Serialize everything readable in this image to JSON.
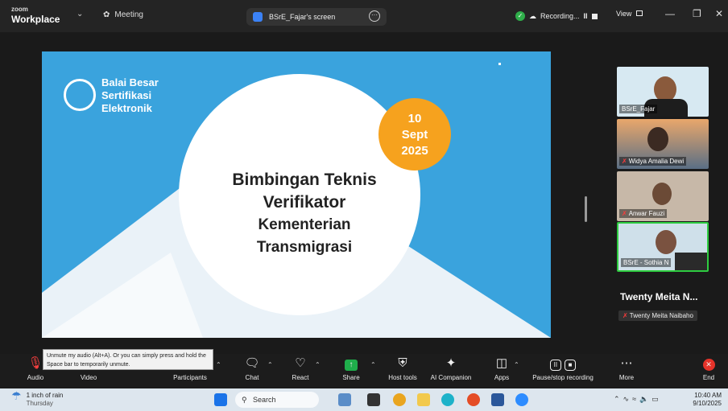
{
  "titlebar": {
    "brand_line1": "zoom",
    "brand_line2": "Workplace",
    "meeting_tab": "Meeting",
    "share_tab": "BSrE_Fajar's screen",
    "recording_label": "Recording...",
    "view_label": "View"
  },
  "slide": {
    "logo_lines": [
      "Balai Besar",
      "Sertifikasi",
      "Elektronik"
    ],
    "date_lines": [
      "10",
      "Sept",
      "2025"
    ],
    "title_lines": [
      "Bimbingan Teknis",
      "Verifikator",
      "Kementerian",
      "Transmigrasi"
    ],
    "colors": {
      "background": "#3aa3dd",
      "accent": "#f6a21e"
    }
  },
  "participants": [
    {
      "name": "BSrE_Fajar",
      "muted": false
    },
    {
      "name": "Widya Amalia Dewi",
      "muted": true
    },
    {
      "name": "Anwar Fauzi",
      "muted": true
    },
    {
      "name": "BSrE - Sothia N",
      "muted": false
    }
  ],
  "speaker": {
    "name": "Twenty Meita N...",
    "sub_label": "Twenty Meita Naibaho"
  },
  "tooltip": {
    "text": "Unmute my audio (Alt+A). Or you can simply press and hold the Space bar to temporarily unmute."
  },
  "toolbar": {
    "audio": "Audio",
    "video": "Video",
    "participants": "Participants",
    "chat": "Chat",
    "react": "React",
    "share": "Share",
    "host_tools": "Host tools",
    "ai_companion": "AI Companion",
    "apps": "Apps",
    "pause_recording": "Pause/stop recording",
    "more": "More",
    "end": "End"
  },
  "taskbar": {
    "weather_line1": "1 inch of rain",
    "weather_line2": "Thursday",
    "search_placeholder": "Search",
    "time": "10:40 AM",
    "date": "9/10/2025"
  }
}
